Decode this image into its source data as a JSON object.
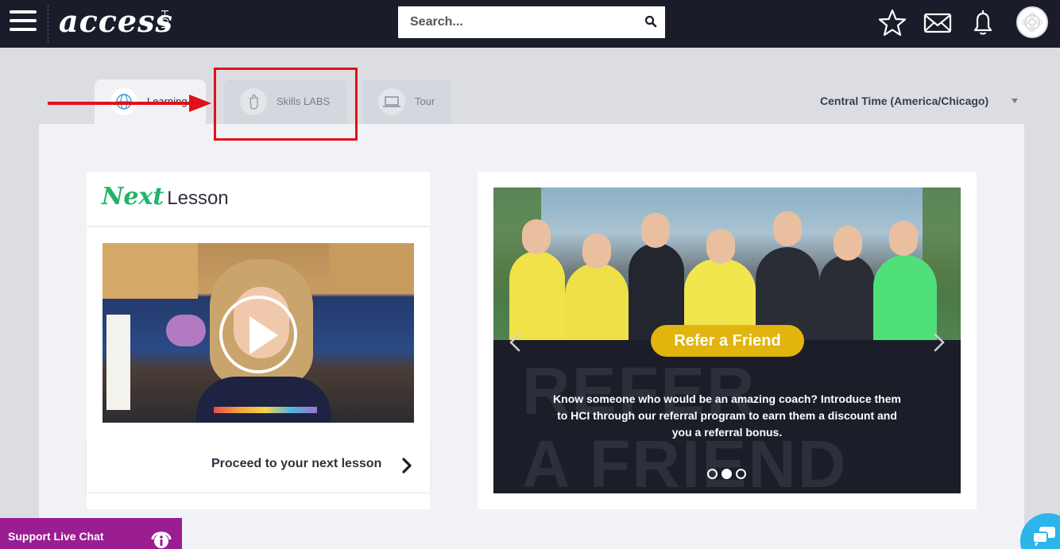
{
  "header": {
    "logo_text": "access",
    "logo_sub": "HCI",
    "search_placeholder": "Search..."
  },
  "tabs": [
    {
      "label": "Learning",
      "icon": "globe-icon",
      "active": true
    },
    {
      "label": "Skills LABS",
      "icon": "hand-icon",
      "active": false
    },
    {
      "label": "Tour",
      "icon": "laptop-icon",
      "active": false
    }
  ],
  "timezone": {
    "label": "Central Time (America/Chicago)"
  },
  "next_lesson": {
    "title_script": "Next",
    "title_rest": "Lesson",
    "proceed_label": "Proceed to your next lesson"
  },
  "carousel": {
    "button_label": "Refer a Friend",
    "bg_line1": "REFER",
    "bg_line2": "A FRIEND",
    "description": "Know someone who would be an amazing coach? Introduce them to HCI through our referral program to earn them a discount and you a referral bonus.",
    "active_dot": 2,
    "dot_count": 3
  },
  "support": {
    "label": "Support Live Chat"
  },
  "colors": {
    "topbar": "#1a1d29",
    "accent_green": "#1fb46a",
    "refer_yellow": "#e2b40e",
    "support_purple": "#9b1d92",
    "annotation_red": "#e3101a",
    "chat_blue": "#2bb5e8"
  }
}
